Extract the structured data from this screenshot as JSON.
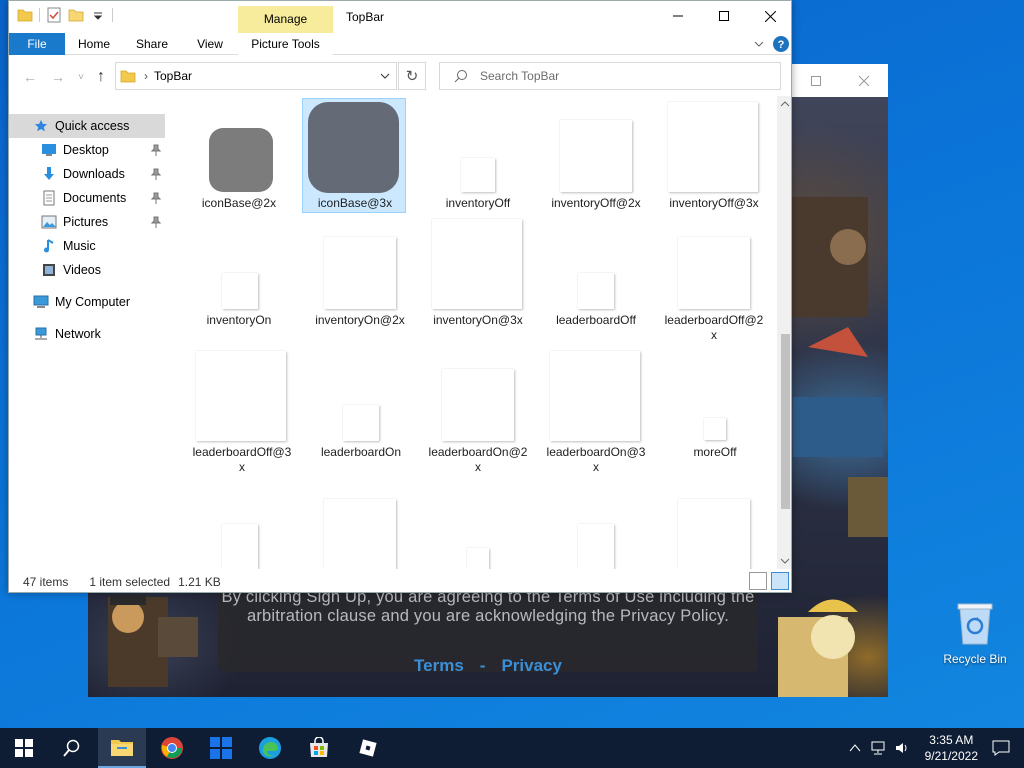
{
  "desktop": {
    "recycle_bin_label": "Recycle Bin"
  },
  "roblox": {
    "signup_text": "By clicking Sign Up, you are agreeing to the Terms of Use including the arbitration clause and you are acknowledging the Privacy Policy.",
    "terms_link": "Terms",
    "separator": "-",
    "privacy_link": "Privacy"
  },
  "explorer": {
    "title": "TopBar",
    "manage_tab": "Manage",
    "picture_tools_tab": "Picture Tools",
    "tabs": [
      "File",
      "Home",
      "Share",
      "View"
    ],
    "address_path": "TopBar",
    "search_placeholder": "Search TopBar",
    "nav": {
      "quick_access": "Quick access",
      "items": [
        {
          "label": "Desktop",
          "icon": "desktop-icon",
          "pinned": true
        },
        {
          "label": "Downloads",
          "icon": "downloads-icon",
          "pinned": true
        },
        {
          "label": "Documents",
          "icon": "documents-icon",
          "pinned": true
        },
        {
          "label": "Pictures",
          "icon": "pictures-icon",
          "pinned": true
        },
        {
          "label": "Music",
          "icon": "music-icon",
          "pinned": false
        },
        {
          "label": "Videos",
          "icon": "videos-icon",
          "pinned": false
        }
      ],
      "my_computer": "My Computer",
      "network": "Network"
    },
    "files": [
      {
        "label": "iconBase@2x",
        "selected": false
      },
      {
        "label": "iconBase@3x",
        "selected": true
      },
      {
        "label": "inventoryOff",
        "selected": false
      },
      {
        "label": "inventoryOff@2x",
        "selected": false
      },
      {
        "label": "inventoryOff@3x",
        "selected": false
      },
      {
        "label": "inventoryOn",
        "selected": false
      },
      {
        "label": "inventoryOn@2x",
        "selected": false
      },
      {
        "label": "inventoryOn@3x",
        "selected": false
      },
      {
        "label": "leaderboardOff",
        "selected": false
      },
      {
        "label": "leaderboardOff@2x",
        "selected": false
      },
      {
        "label": "leaderboardOff@3x",
        "selected": false
      },
      {
        "label": "leaderboardOn",
        "selected": false
      },
      {
        "label": "leaderboardOn@2x",
        "selected": false
      },
      {
        "label": "leaderboardOn@3x",
        "selected": false
      },
      {
        "label": "moreOff",
        "selected": false
      }
    ],
    "status": {
      "item_count": "47 items",
      "selection": "1 item selected",
      "size": "1.21 KB"
    }
  },
  "taskbar": {
    "apps": [
      "start-icon",
      "search-icon",
      "file-explorer-icon",
      "chrome-icon",
      "windows-store-tiles-icon",
      "edge-icon",
      "store-icon",
      "roblox-icon"
    ],
    "time": "3:35 AM",
    "date": "9/21/2022"
  },
  "colors": {
    "accent": "#1979ca",
    "manage_tab": "#f7ec9b",
    "selection": "#cce8ff",
    "taskbar": "#0e1d33",
    "desktop": "#0b74d8"
  }
}
